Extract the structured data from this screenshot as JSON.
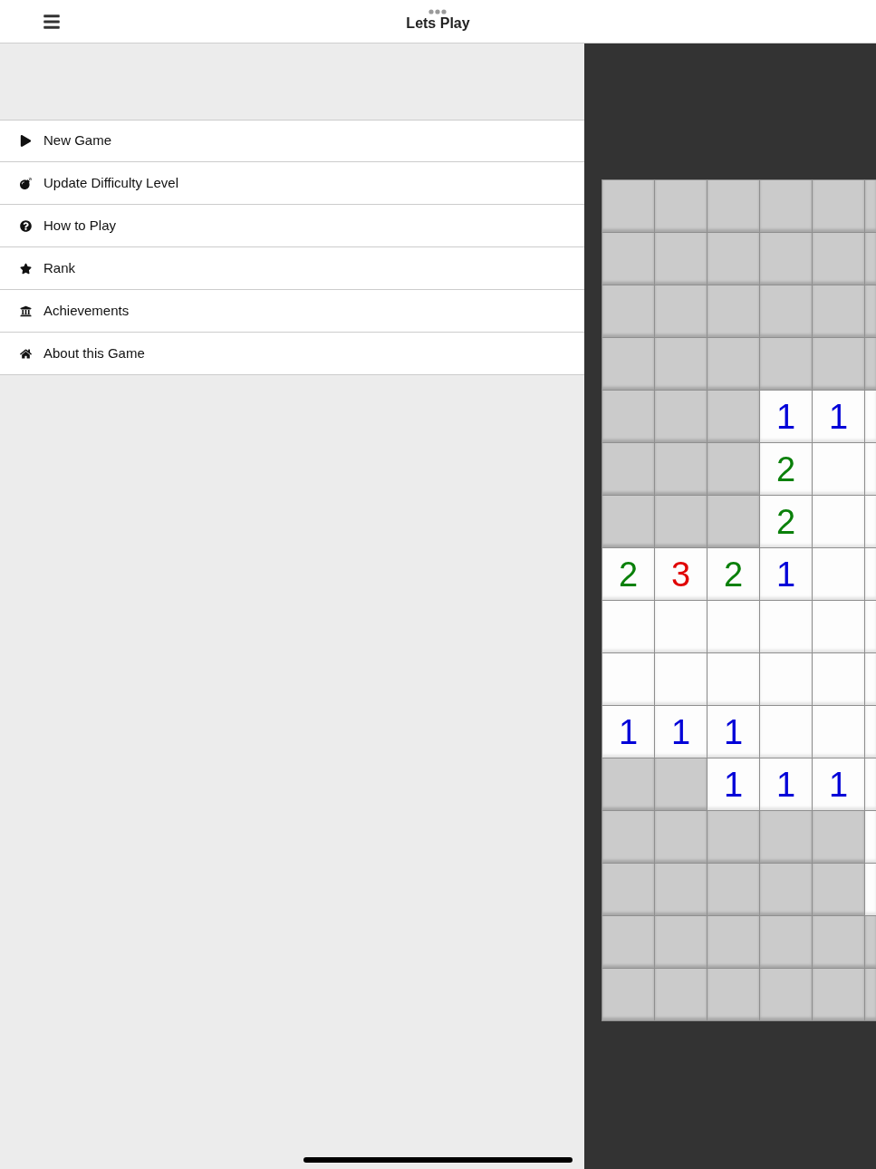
{
  "header": {
    "title": "Lets Play"
  },
  "menu": {
    "items": [
      {
        "label": "New Game"
      },
      {
        "label": "Update Difficulty Level"
      },
      {
        "label": "How to Play"
      },
      {
        "label": "Rank"
      },
      {
        "label": "Achievements"
      },
      {
        "label": "About this Game"
      }
    ]
  },
  "board": {
    "rows": [
      [
        {
          "revealed": false
        },
        {
          "revealed": false
        },
        {
          "revealed": false
        },
        {
          "revealed": false
        },
        {
          "revealed": false
        },
        {
          "revealed": false
        }
      ],
      [
        {
          "revealed": false
        },
        {
          "revealed": false
        },
        {
          "revealed": false
        },
        {
          "revealed": false
        },
        {
          "revealed": false
        },
        {
          "revealed": false
        }
      ],
      [
        {
          "revealed": false
        },
        {
          "revealed": false
        },
        {
          "revealed": false
        },
        {
          "revealed": false
        },
        {
          "revealed": false
        },
        {
          "revealed": false
        }
      ],
      [
        {
          "revealed": false
        },
        {
          "revealed": false
        },
        {
          "revealed": false
        },
        {
          "revealed": false
        },
        {
          "revealed": false
        },
        {
          "revealed": false
        }
      ],
      [
        {
          "revealed": false
        },
        {
          "revealed": false
        },
        {
          "revealed": false
        },
        {
          "revealed": true,
          "value": "1",
          "color": "#0000d8"
        },
        {
          "revealed": true,
          "value": "1",
          "color": "#0000d8"
        },
        {
          "revealed": true
        }
      ],
      [
        {
          "revealed": false
        },
        {
          "revealed": false
        },
        {
          "revealed": false
        },
        {
          "revealed": true,
          "value": "2",
          "color": "#0a800a"
        },
        {
          "revealed": true
        },
        {
          "revealed": true
        }
      ],
      [
        {
          "revealed": false
        },
        {
          "revealed": false
        },
        {
          "revealed": false
        },
        {
          "revealed": true,
          "value": "2",
          "color": "#0a800a"
        },
        {
          "revealed": true
        },
        {
          "revealed": true
        }
      ],
      [
        {
          "revealed": true,
          "value": "2",
          "color": "#0a800a"
        },
        {
          "revealed": true,
          "value": "3",
          "color": "#e00000"
        },
        {
          "revealed": true,
          "value": "2",
          "color": "#0a800a"
        },
        {
          "revealed": true,
          "value": "1",
          "color": "#0000d8"
        },
        {
          "revealed": true
        },
        {
          "revealed": true
        }
      ],
      [
        {
          "revealed": true
        },
        {
          "revealed": true
        },
        {
          "revealed": true
        },
        {
          "revealed": true
        },
        {
          "revealed": true
        },
        {
          "revealed": true
        }
      ],
      [
        {
          "revealed": true
        },
        {
          "revealed": true
        },
        {
          "revealed": true
        },
        {
          "revealed": true
        },
        {
          "revealed": true
        },
        {
          "revealed": true
        }
      ],
      [
        {
          "revealed": true,
          "value": "1",
          "color": "#0000d8"
        },
        {
          "revealed": true,
          "value": "1",
          "color": "#0000d8"
        },
        {
          "revealed": true,
          "value": "1",
          "color": "#0000d8"
        },
        {
          "revealed": true
        },
        {
          "revealed": true
        },
        {
          "revealed": true
        }
      ],
      [
        {
          "revealed": false
        },
        {
          "revealed": false
        },
        {
          "revealed": true,
          "value": "1",
          "color": "#0000d8"
        },
        {
          "revealed": true,
          "value": "1",
          "color": "#0000d8"
        },
        {
          "revealed": true,
          "value": "1",
          "color": "#0000d8"
        },
        {
          "revealed": true
        }
      ],
      [
        {
          "revealed": false
        },
        {
          "revealed": false
        },
        {
          "revealed": false
        },
        {
          "revealed": false
        },
        {
          "revealed": false
        },
        {
          "revealed": true
        }
      ],
      [
        {
          "revealed": false
        },
        {
          "revealed": false
        },
        {
          "revealed": false
        },
        {
          "revealed": false
        },
        {
          "revealed": false
        },
        {
          "revealed": true
        }
      ],
      [
        {
          "revealed": false
        },
        {
          "revealed": false
        },
        {
          "revealed": false
        },
        {
          "revealed": false
        },
        {
          "revealed": false
        },
        {
          "revealed": false
        }
      ],
      [
        {
          "revealed": false
        },
        {
          "revealed": false
        },
        {
          "revealed": false
        },
        {
          "revealed": false
        },
        {
          "revealed": false
        },
        {
          "revealed": false
        }
      ]
    ]
  }
}
